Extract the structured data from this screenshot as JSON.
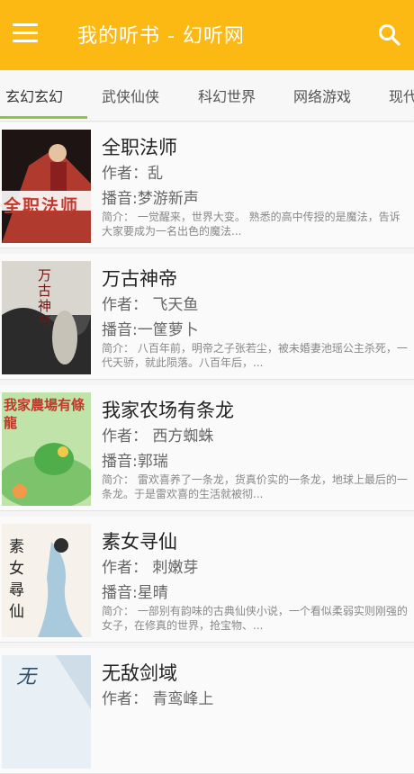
{
  "appbar": {
    "title": "我的听书 - 幻听网"
  },
  "tabs": [
    {
      "label": "玄幻玄幻"
    },
    {
      "label": "武侠仙侠"
    },
    {
      "label": "科幻世界"
    },
    {
      "label": "网络游戏"
    },
    {
      "label": "现代"
    }
  ],
  "labels": {
    "author_prefix": "作者：",
    "narrator_prefix": "播音:",
    "intro_prefix": "简介："
  },
  "books": [
    {
      "title": "全职法师",
      "author": "作者：乱",
      "narrator": "播音:梦游新声",
      "intro": "简介： 一觉醒来，世界大变。        熟悉的高中传授的是魔法，告诉大家要成为一名出色的魔法...",
      "cover_text": "全职法师",
      "cover_palette": [
        "#2a1a1a",
        "#c0392b"
      ]
    },
    {
      "title": "万古神帝",
      "author": "作者： 飞天鱼",
      "narrator": "播音:一筐萝卜",
      "intro": "简介： 八百年前，明帝之子张若尘，被未婚妻池瑶公主杀死，一代天骄，就此陨落。八百年后，...",
      "cover_text": "万古神帝",
      "cover_palette": [
        "#3a3a3a",
        "#c9c9c9"
      ]
    },
    {
      "title": "我家农场有条龙",
      "author": "作者： 西方蜘蛛",
      "narrator": "播音:郭瑞",
      "intro": "简介： 雷欢喜养了一条龙，货真价实的一条龙，地球上最后的一条龙。于是雷欢喜的生活就被彻...",
      "cover_text": "我家農場有條龍",
      "cover_palette": [
        "#7cc36b",
        "#f2c94c"
      ]
    },
    {
      "title": "素女寻仙",
      "author": "作者： 刺嫩芽",
      "narrator": "播音:星晴",
      "intro": "简介： 一部别有韵味的古典仙侠小说，一个看似柔弱实则刚强的女子，在修真的世界，抢宝物、...",
      "cover_text": "素女尋仙",
      "cover_palette": [
        "#f6f1ea",
        "#7aa6c2"
      ]
    },
    {
      "title": "无敌剑域",
      "author": "作者： 青鸾峰上",
      "narrator": "",
      "intro": "",
      "cover_text": "无",
      "cover_palette": [
        "#e8f0f6",
        "#4a6a8a"
      ]
    }
  ],
  "colors": {
    "primary": "#fdb913",
    "tab_indicator": "#8cc63f"
  },
  "icons": {
    "menu": "menu-icon",
    "search": "search-icon"
  }
}
